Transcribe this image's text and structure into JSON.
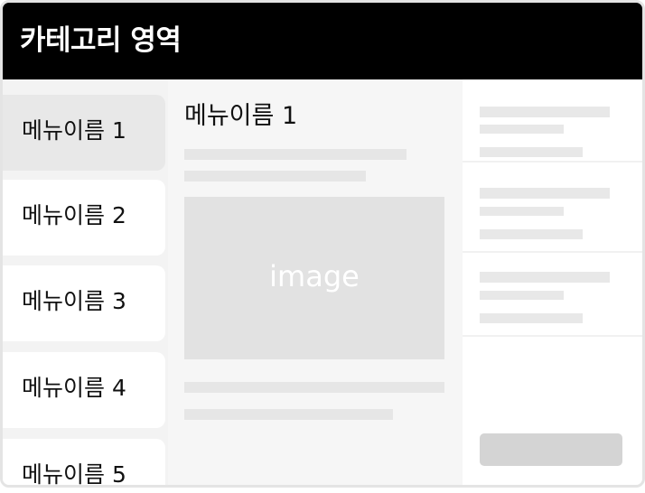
{
  "header": {
    "title": "카테고리 영역"
  },
  "sidebar": {
    "items": [
      {
        "label": "메뉴이름 1",
        "active": true
      },
      {
        "label": "메뉴이름 2",
        "active": false
      },
      {
        "label": "메뉴이름 3",
        "active": false
      },
      {
        "label": "메뉴이름 4",
        "active": false
      },
      {
        "label": "메뉴이름 5",
        "active": false
      }
    ]
  },
  "main": {
    "title": "메뉴이름 1",
    "image_label": "image"
  },
  "colors": {
    "header_background": "#000000",
    "header_text": "#ffffff",
    "active_menu_background": "#e8e8e8",
    "menu_background": "#ffffff",
    "placeholder": "#e6e6e6",
    "button_placeholder": "#d4d4d4"
  }
}
